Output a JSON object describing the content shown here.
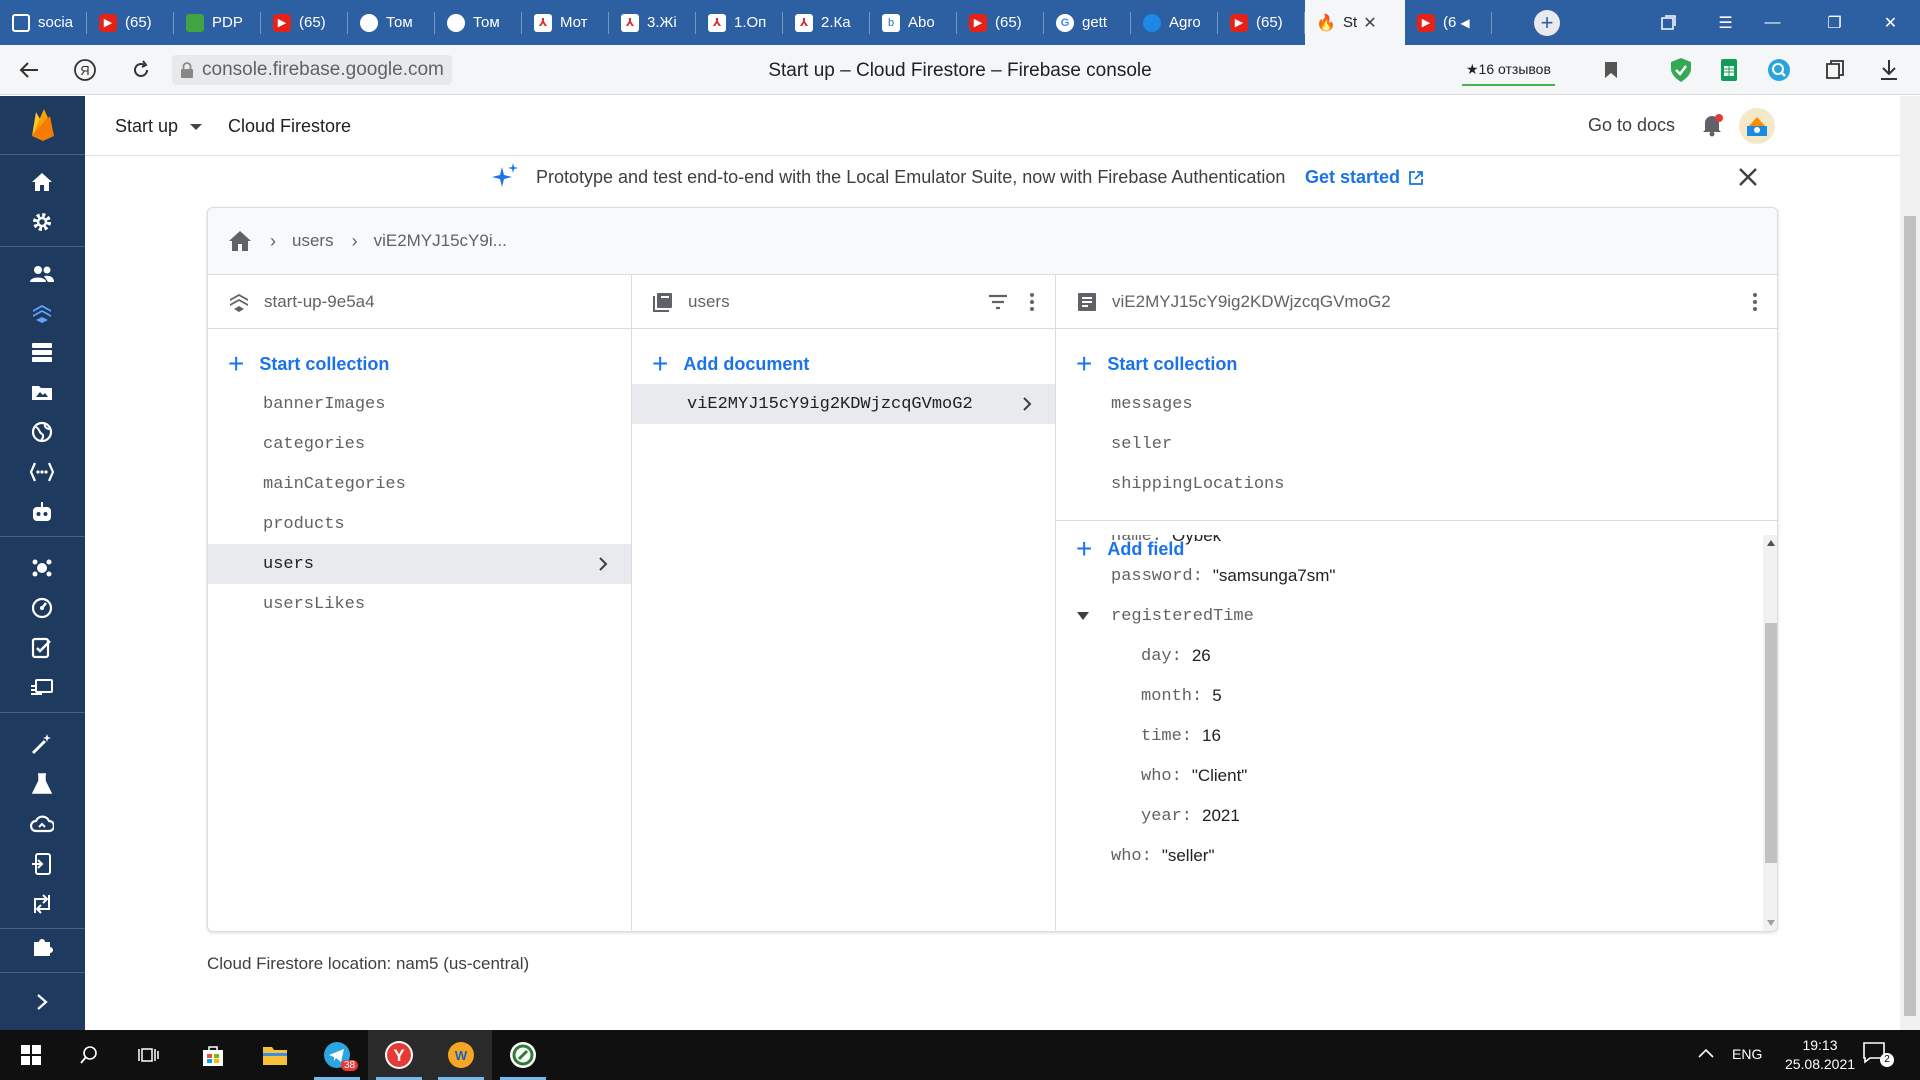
{
  "browser": {
    "tabs": [
      {
        "label": "socia",
        "icon": "document-icon"
      },
      {
        "label": "(65)",
        "icon": "youtube-icon"
      },
      {
        "label": "PDP",
        "icon": "pdp-icon"
      },
      {
        "label": "(65)",
        "icon": "youtube-icon"
      },
      {
        "label": "Том",
        "icon": "telegram-icon"
      },
      {
        "label": "Том",
        "icon": "telegram-icon"
      },
      {
        "label": "Мот",
        "icon": "pdf-icon"
      },
      {
        "label": "3.Жі",
        "icon": "pdf-icon"
      },
      {
        "label": "1.Оп",
        "icon": "pdf-icon"
      },
      {
        "label": "2.Ка",
        "icon": "pdf-icon"
      },
      {
        "label": "Abo",
        "icon": "bookmark-site-icon"
      },
      {
        "label": "(65)",
        "icon": "youtube-icon"
      },
      {
        "label": "gett",
        "icon": "google-icon"
      },
      {
        "label": "Agro",
        "icon": "agro-icon"
      },
      {
        "label": "(65)",
        "icon": "youtube-icon"
      },
      {
        "label": "St",
        "icon": "firebase-icon",
        "active": true
      },
      {
        "label": "(6",
        "icon": "youtube-icon",
        "audio": true
      }
    ],
    "url": "console.firebase.google.com",
    "page_title": "Start up – Cloud Firestore – Firebase console",
    "reviews": "★16 отзывов"
  },
  "header": {
    "project": "Start up",
    "section": "Cloud Firestore",
    "docs_link": "Go to docs"
  },
  "banner": {
    "text": "Prototype and test end-to-end with the Local Emulator Suite, now with Firebase Authentication",
    "link": "Get started"
  },
  "breadcrumb": {
    "items": [
      "users",
      "viE2MYJ15cY9i..."
    ]
  },
  "columns": {
    "root": {
      "title": "start-up-9e5a4",
      "add_label": "Start collection",
      "items": [
        "bannerImages",
        "categories",
        "mainCategories",
        "products",
        "users",
        "usersLikes"
      ]
    },
    "collection": {
      "title": "users",
      "add_label": "Add document",
      "items": [
        "viE2MYJ15cY9ig2KDWjzcqGVmoG2"
      ]
    },
    "document": {
      "title": "viE2MYJ15cY9ig2KDWjzcqGVmoG2",
      "add_collection_label": "Start collection",
      "subcollections": [
        "messages",
        "seller",
        "shippingLocations"
      ],
      "add_field_label": "Add field",
      "fields": {
        "name_key": "name:",
        "name_val": "Oybek",
        "password_key": "password:",
        "password_val": "\"samsunga7sm\"",
        "registered_key": "registeredTime",
        "day_key": "day:",
        "day_val": "26",
        "month_key": "month:",
        "month_val": "5",
        "time_key": "time:",
        "time_val": "16",
        "who_inner_key": "who:",
        "who_inner_val": "\"Client\"",
        "year_key": "year:",
        "year_val": "2021",
        "who_key": "who:",
        "who_val": "\"seller\""
      }
    }
  },
  "location": "Cloud Firestore location: nam5 (us-central)",
  "taskbar": {
    "telegram_badge": "38",
    "lang": "ENG",
    "time": "19:13",
    "date": "25.08.2021",
    "notif_count": "2"
  },
  "colors": {
    "tabstrip": "#2d5fa3",
    "firebase_nav": "#1e3a5f",
    "link_blue": "#1a73e8",
    "firebase_orange": "#ffa000"
  }
}
